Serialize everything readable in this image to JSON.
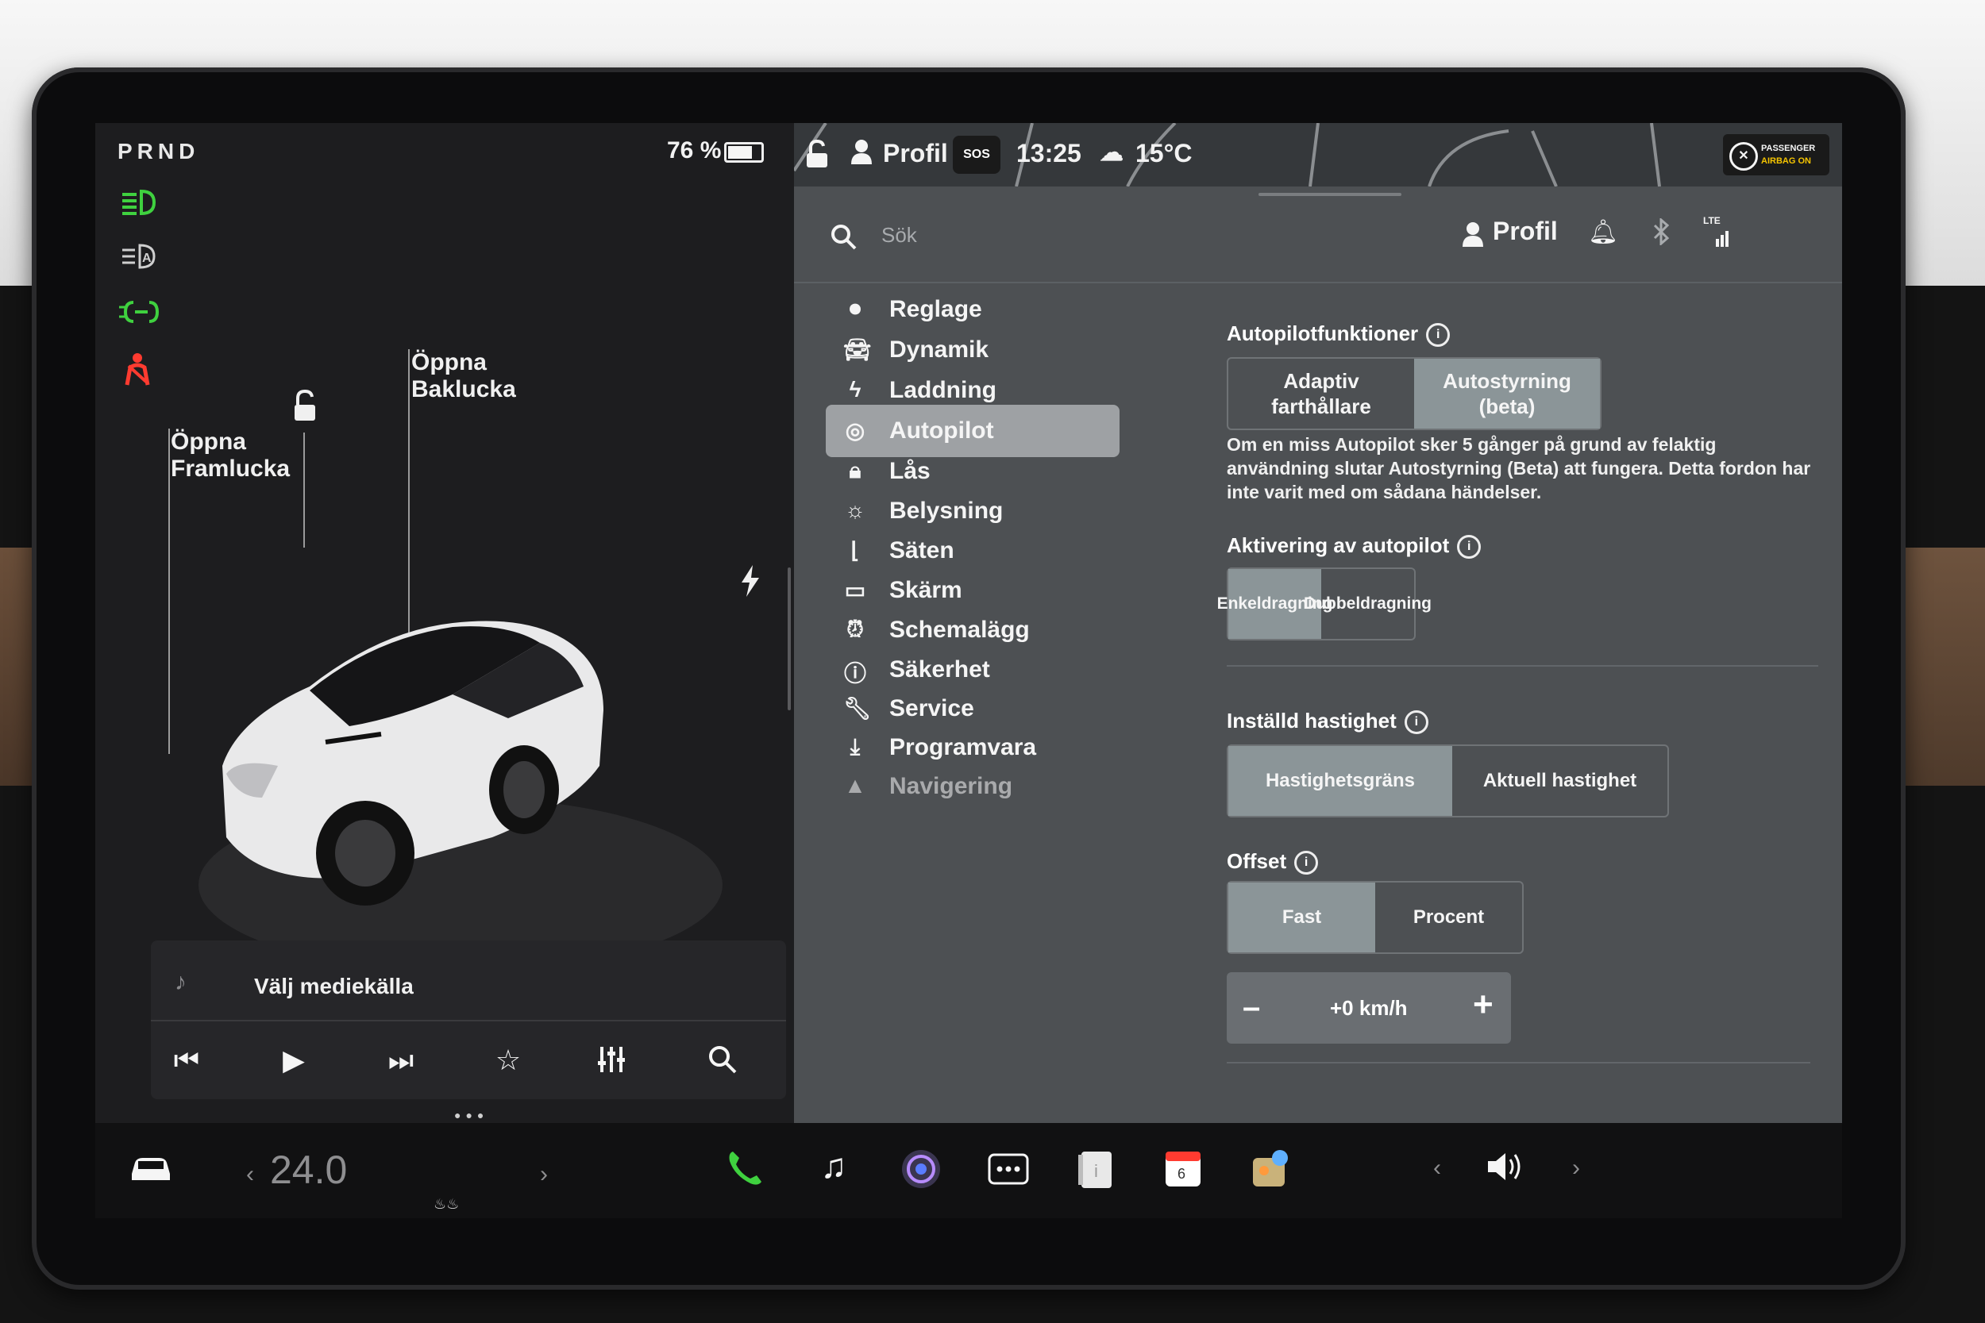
{
  "status": {
    "prnd": "PRND",
    "battery_pct": "76 %"
  },
  "car_view": {
    "front_trunk_label": "Öppna\nFramlucka",
    "rear_trunk_label": "Öppna\nBaklucka"
  },
  "media": {
    "source_label": "Välj mediekälla"
  },
  "topbar": {
    "profile": "Profil",
    "sos": "SOS",
    "time": "13:25",
    "temp": "15°C",
    "airbag_line1": "PASSENGER",
    "airbag_line2": "AIRBAG ON"
  },
  "search": {
    "placeholder": "Sök",
    "profile": "Profil",
    "lte": "LTE"
  },
  "menu": [
    {
      "label": "Reglage",
      "icon": "toggle-icon"
    },
    {
      "label": "Dynamik",
      "icon": "car-icon"
    },
    {
      "label": "Laddning",
      "icon": "bolt-icon"
    },
    {
      "label": "Autopilot",
      "icon": "steering-wheel-icon"
    },
    {
      "label": "Lås",
      "icon": "lock-icon"
    },
    {
      "label": "Belysning",
      "icon": "sun-icon"
    },
    {
      "label": "Säten",
      "icon": "seat-icon"
    },
    {
      "label": "Skärm",
      "icon": "screen-icon"
    },
    {
      "label": "Schemalägg",
      "icon": "alarm-icon"
    },
    {
      "label": "Säkerhet",
      "icon": "alert-icon"
    },
    {
      "label": "Service",
      "icon": "wrench-icon"
    },
    {
      "label": "Programvara",
      "icon": "download-icon"
    },
    {
      "label": "Navigering",
      "icon": "navigation-icon"
    }
  ],
  "active_menu": "Autopilot",
  "autopilot": {
    "features_title": "Autopilotfunktioner",
    "feature_opt1": "Adaptiv\nfarthållare",
    "feature_opt2": "Autostyrning\n(beta)",
    "feature_selected": "Autostyrning (beta)",
    "description": "Om en miss Autopilot sker 5 gånger på grund av felaktig användning slutar Autostyrning (Beta) att fungera. Detta fordon har inte varit med om sådana händelser.",
    "activation_title": "Aktivering av autopilot",
    "activation_opt1": "Enkeldragning",
    "activation_opt2": "Dubbeldragning",
    "activation_selected": "Enkeldragning",
    "speed_title": "Inställd hastighet",
    "speed_opt1": "Hastighetsgräns",
    "speed_opt2": "Aktuell hastighet",
    "speed_selected": "Hastighetsgräns",
    "offset_title": "Offset",
    "offset_opt1": "Fast",
    "offset_opt2": "Procent",
    "offset_selected": "Fast",
    "offset_minus": "–",
    "offset_value": "+0 km/h",
    "offset_plus": "+"
  },
  "dock": {
    "temperature": "24.0",
    "calendar_day": "6"
  },
  "colors": {
    "accent_green": "#3fd13f",
    "seatbelt_red": "#ff3b30",
    "panel_bg": "#4d5053",
    "selected_segment": "#8b9598"
  }
}
